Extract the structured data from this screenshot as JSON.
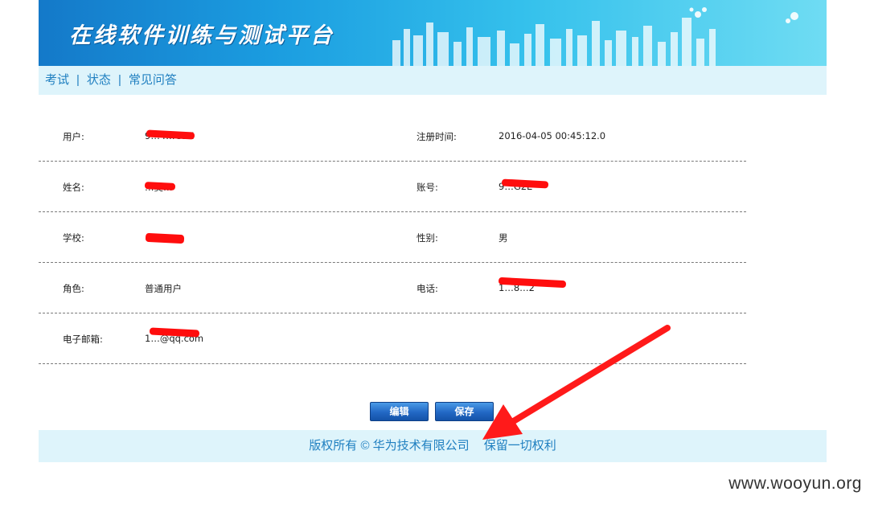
{
  "banner": {
    "title": "在线软件训练与测试平台"
  },
  "nav": {
    "items": [
      {
        "label": "考试"
      },
      {
        "label": "状态"
      },
      {
        "label": "常见问答"
      }
    ],
    "separator": "|"
  },
  "profile": {
    "rows": [
      {
        "left": {
          "label": "用户:",
          "value": "9…4…G2E"
        },
        "right": {
          "label": "注册时间:",
          "value": "2016-04-05 00:45:12.0"
        }
      },
      {
        "left": {
          "label": "姓名:",
          "value": "…奚…"
        },
        "right": {
          "label": "账号:",
          "value": "9…G2E"
        }
      },
      {
        "left": {
          "label": "学校:",
          "value": ""
        },
        "right": {
          "label": "性别:",
          "value": "男"
        }
      },
      {
        "left": {
          "label": "角色:",
          "value": "普通用户"
        },
        "right": {
          "label": "电话:",
          "value": "1…8…2"
        }
      },
      {
        "left": {
          "label": "电子邮箱:",
          "value": "1…@qq.com"
        },
        "right": {
          "label": "",
          "value": ""
        }
      }
    ]
  },
  "buttons": {
    "edit": "编辑",
    "save": "保存"
  },
  "footer": {
    "copyright": "版权所有 © 华为技术有限公司",
    "rights": "保留一切权利"
  },
  "watermark": "www.wooyun.org",
  "colors": {
    "accent": "#1f7fc0",
    "light_bar": "#def4fb",
    "button": "#2268c4",
    "annotation_arrow": "#ff1a1a"
  }
}
